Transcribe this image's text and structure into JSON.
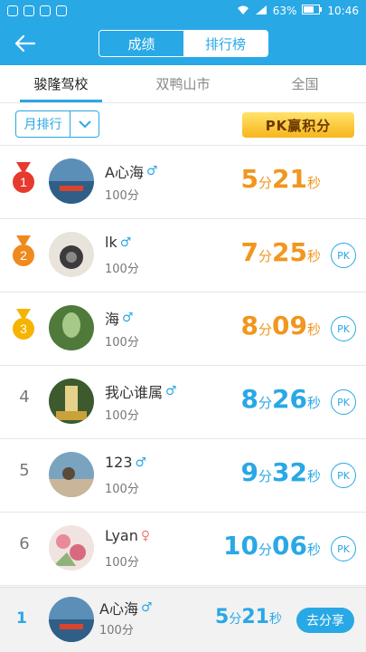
{
  "status_bar": {
    "battery": "63%",
    "time": "10:46"
  },
  "header": {
    "tabs": [
      {
        "label": "成绩"
      },
      {
        "label": "排行榜"
      }
    ]
  },
  "region_tabs": [
    {
      "label": "骏隆驾校"
    },
    {
      "label": "双鸭山市"
    },
    {
      "label": "全国"
    }
  ],
  "filter": {
    "label": "月排行"
  },
  "pk_banner": {
    "label": "PK赢积分"
  },
  "gender_symbols": {
    "male": "♂",
    "female": "♀"
  },
  "ranking": [
    {
      "rank": "1",
      "name": "A心海",
      "gender": "male",
      "score": "100分",
      "time_min": "5",
      "min_unit": "分",
      "time_sec": "21",
      "sec_unit": "秒",
      "has_pk": false
    },
    {
      "rank": "2",
      "name": "lk",
      "gender": "male",
      "score": "100分",
      "time_min": "7",
      "min_unit": "分",
      "time_sec": "25",
      "sec_unit": "秒",
      "has_pk": true
    },
    {
      "rank": "3",
      "name": "海",
      "gender": "male",
      "score": "100分",
      "time_min": "8",
      "min_unit": "分",
      "time_sec": "09",
      "sec_unit": "秒",
      "has_pk": true
    },
    {
      "rank": "4",
      "name": "我心谁属",
      "gender": "male",
      "score": "100分",
      "time_min": "8",
      "min_unit": "分",
      "time_sec": "26",
      "sec_unit": "秒",
      "has_pk": true
    },
    {
      "rank": "5",
      "name": "123",
      "gender": "male",
      "score": "100分",
      "time_min": "9",
      "min_unit": "分",
      "time_sec": "32",
      "sec_unit": "秒",
      "has_pk": true
    },
    {
      "rank": "6",
      "name": "Lyan",
      "gender": "female",
      "score": "100分",
      "time_min": "10",
      "min_unit": "分",
      "time_sec": "06",
      "sec_unit": "秒",
      "has_pk": true
    }
  ],
  "pk_label": "PK",
  "footer": {
    "rank": "1",
    "name": "A心海",
    "score": "100分",
    "time_min": "5",
    "min_unit": "分",
    "time_sec": "21",
    "sec_unit": "秒",
    "share_label": "去分享"
  },
  "colors": {
    "primary": "#29a8e6",
    "gold": "#f1961e",
    "medal_red": "#e63a2e",
    "medal_orange": "#f08a1c",
    "medal_yellow": "#f5b400"
  }
}
